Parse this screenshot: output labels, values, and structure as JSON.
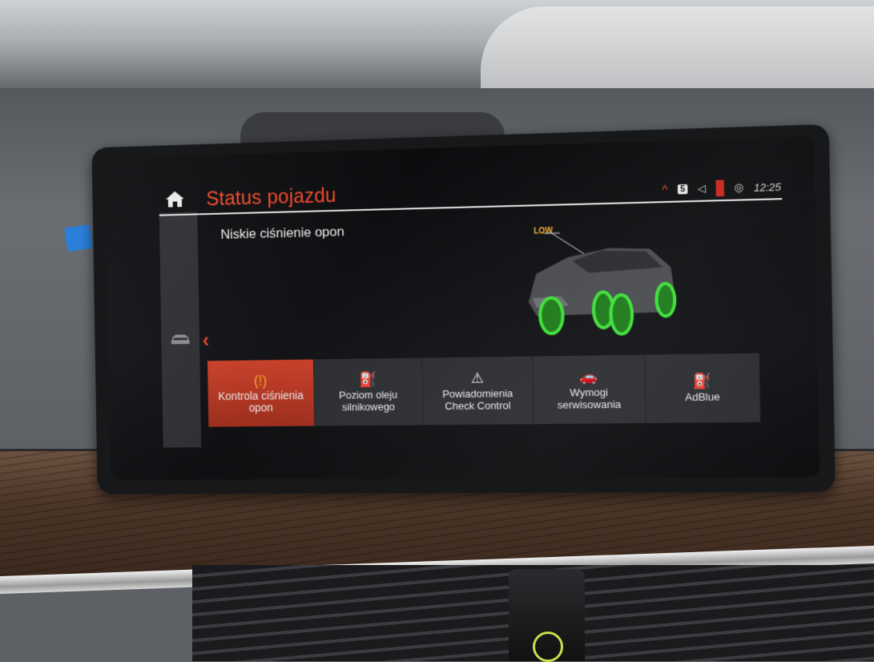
{
  "header": {
    "title": "Status pojazdu",
    "time": "12:25",
    "badge": "5"
  },
  "main": {
    "subtitle": "Niskie ciśnienie opon",
    "warning_label": "LOW"
  },
  "tabs": [
    {
      "line1": "Kontrola ciśnienia",
      "line2": "opon",
      "icon": "tire-pressure-warning-icon",
      "active": true
    },
    {
      "line1": "Poziom oleju",
      "line2": "silnikowego",
      "icon": "oil-can-icon",
      "active": false
    },
    {
      "line1": "Powiadomienia",
      "line2": "Check Control",
      "icon": "warning-triangle-icon",
      "active": false
    },
    {
      "line1": "Wymogi",
      "line2": "serwisowania",
      "icon": "service-car-icon",
      "active": false
    },
    {
      "line1": "AdBlue",
      "line2": "",
      "icon": "adblue-icon",
      "active": false
    }
  ],
  "colors": {
    "accent": "#f04a2c",
    "wheel_highlight": "#3fe03a",
    "warning": "#f7b23a"
  }
}
